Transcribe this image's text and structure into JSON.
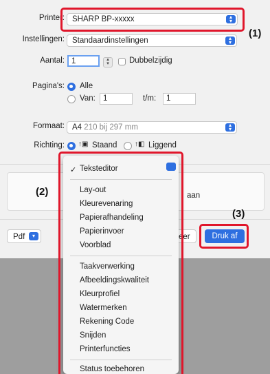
{
  "printer": {
    "label": "Printer:",
    "value": "SHARP BP-xxxxx"
  },
  "settings": {
    "label": "Instellingen:",
    "value": "Standaardinstellingen"
  },
  "copies": {
    "label": "Aantal:",
    "value": "1",
    "duplex_label": "Dubbelzijdig"
  },
  "pages": {
    "label": "Pagina's:",
    "all_label": "Alle",
    "from_label": "Van:",
    "from_value": "1",
    "to_label": "t/m:",
    "to_value": "1"
  },
  "format": {
    "label": "Formaat:",
    "value_bold": "A4",
    "value_detail": "210 bij 297 mm"
  },
  "orientation": {
    "label": "Richting:",
    "portrait": "Staand",
    "landscape": "Liggend"
  },
  "partial_text": {
    "left": "",
    "right": "aan"
  },
  "bottom": {
    "pdf_label": "Pdf",
    "cancel_partial": "leer",
    "print_label": "Druk af"
  },
  "callouts": {
    "c1": "(1)",
    "c2": "(2)",
    "c3": "(3)"
  },
  "menu": {
    "selected": "Teksteditor",
    "group1": [
      "Lay-out",
      "Kleurevenaring",
      "Papierafhandeling",
      "Papierinvoer",
      "Voorblad"
    ],
    "group2": [
      "Taakverwerking",
      "Afbeeldingskwaliteit",
      "Kleurprofiel",
      "Watermerken",
      "Rekening Code",
      "Snijden",
      "Printerfuncties"
    ],
    "group3": [
      "Status toebehoren"
    ]
  },
  "icons": {
    "popup": "chevron-updown-icon",
    "dropdown": "chevron-down-icon",
    "portrait": "portrait-icon",
    "landscape": "landscape-icon",
    "check": "checkmark-icon"
  },
  "colors": {
    "accent": "#2e6fe0",
    "highlight": "#e0162b"
  }
}
